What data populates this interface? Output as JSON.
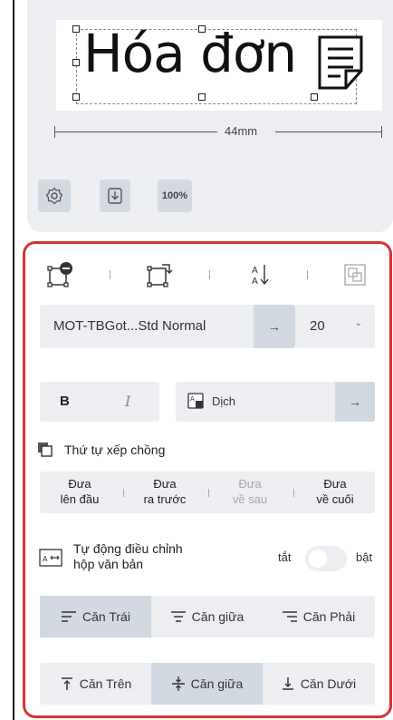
{
  "preview": {
    "text": "Hóa đơn",
    "width_label": "44mm",
    "zoom_label": "100%"
  },
  "panel": {
    "font_name": "MOT-TBGot...Std Normal",
    "arrow": "→",
    "font_size": "20",
    "size_chevron": "⌄",
    "bold_label": "B",
    "italic_label": "I",
    "translate_label": "Dịch",
    "stack_order_title": "Thứ tự xếp chồng",
    "order": [
      {
        "line1": "Đưa",
        "line2": "lên đầu",
        "enabled": true
      },
      {
        "line1": "Đưa",
        "line2": "ra trước",
        "enabled": true
      },
      {
        "line1": "Đưa",
        "line2": "về sau",
        "enabled": false
      },
      {
        "line1": "Đưa",
        "line2": "về cuối",
        "enabled": true
      }
    ],
    "autofit_line1": "Tự động điều chỉnh",
    "autofit_line2": "hộp văn bản",
    "toggle_off": "tắt",
    "toggle_on": "bật",
    "h_align": [
      {
        "label": "Căn Trái",
        "active": true
      },
      {
        "label": "Căn giữa",
        "active": false
      },
      {
        "label": "Căn Phải",
        "active": false
      }
    ],
    "v_align": [
      {
        "label": "Căn Trên",
        "active": false
      },
      {
        "label": "Căn giữa",
        "active": true
      },
      {
        "label": "Căn Dưới",
        "active": false
      }
    ]
  },
  "colors": {
    "panel_border": "#d9322c",
    "field_bg": "#eceef1",
    "active_bg": "#d3d9e0"
  }
}
